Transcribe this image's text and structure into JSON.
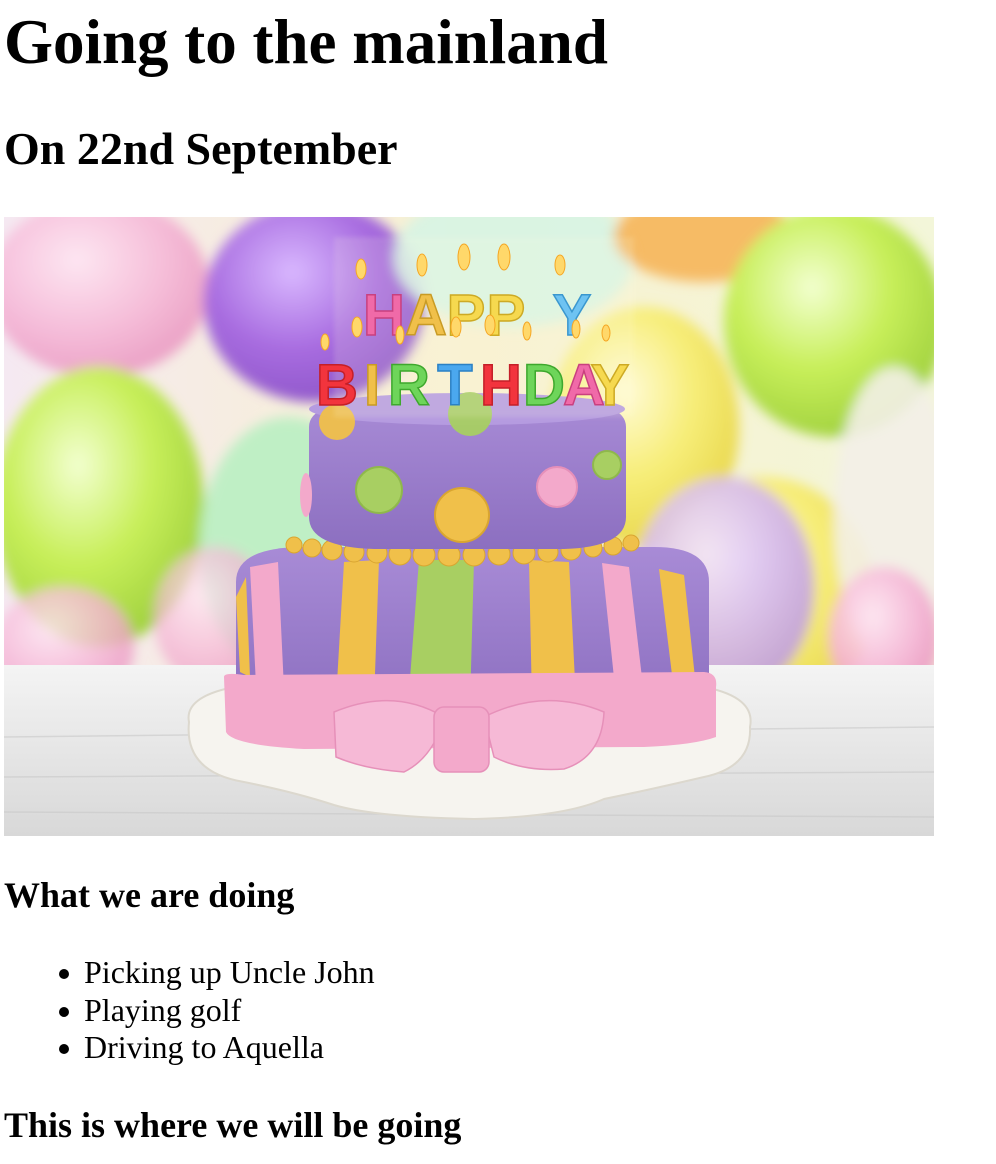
{
  "page": {
    "title": "Going to the mainland",
    "subtitle": "On 22nd September"
  },
  "image": {
    "alt": "Birthday cake",
    "candle_letters": [
      "H",
      "A",
      "P",
      "P",
      "Y",
      "B",
      "I",
      "R",
      "T",
      "H",
      "D",
      "A",
      "Y"
    ]
  },
  "activities": {
    "heading": "What we are doing",
    "items": [
      "Picking up Uncle John",
      "Playing golf",
      "Driving to Aquella"
    ]
  },
  "destination": {
    "heading": "This is where we will be going"
  },
  "colors": {
    "cake_purple": "#9b7fc9",
    "ribbon_pink": "#f3a9cb",
    "stripe_yellow": "#f0c04a",
    "stripe_green": "#a8cf62",
    "balloon_green": "#c8ef5a",
    "balloon_purple": "#a86ce0"
  }
}
